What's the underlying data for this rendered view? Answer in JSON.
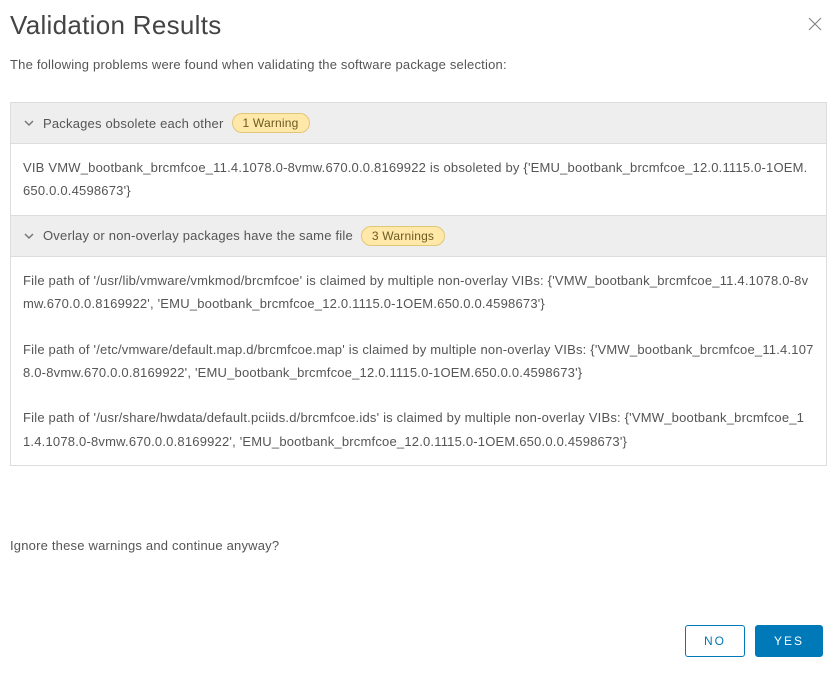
{
  "dialog": {
    "title": "Validation Results",
    "description": "The following problems were found when validating the software package selection:"
  },
  "panels": [
    {
      "title": "Packages obsolete each other",
      "badge": "1 Warning",
      "items": [
        "VIB VMW_bootbank_brcmfcoe_11.4.1078.0-8vmw.670.0.0.8169922 is obsoleted by {'EMU_bootbank_brcmfcoe_12.0.1115.0-1OEM.650.0.0.4598673'}"
      ]
    },
    {
      "title": "Overlay or non-overlay packages have the same file",
      "badge": "3 Warnings",
      "items": [
        "File path of '/usr/lib/vmware/vmkmod/brcmfcoe' is claimed by multiple non-overlay VIBs: {'VMW_bootbank_brcmfcoe_11.4.1078.0-8vmw.670.0.0.8169922', 'EMU_bootbank_brcmfcoe_12.0.1115.0-1OEM.650.0.0.4598673'}",
        "File path of '/etc/vmware/default.map.d/brcmfcoe.map' is claimed by multiple non-overlay VIBs: {'VMW_bootbank_brcmfcoe_11.4.1078.0-8vmw.670.0.0.8169922', 'EMU_bootbank_brcmfcoe_12.0.1115.0-1OEM.650.0.0.4598673'}",
        "File path of '/usr/share/hwdata/default.pciids.d/brcmfcoe.ids' is claimed by multiple non-overlay VIBs: {'VMW_bootbank_brcmfcoe_11.4.1078.0-8vmw.670.0.0.8169922', 'EMU_bootbank_brcmfcoe_12.0.1115.0-1OEM.650.0.0.4598673'}"
      ]
    }
  ],
  "footer": {
    "question": "Ignore these warnings and continue anyway?",
    "no": "NO",
    "yes": "YES"
  }
}
